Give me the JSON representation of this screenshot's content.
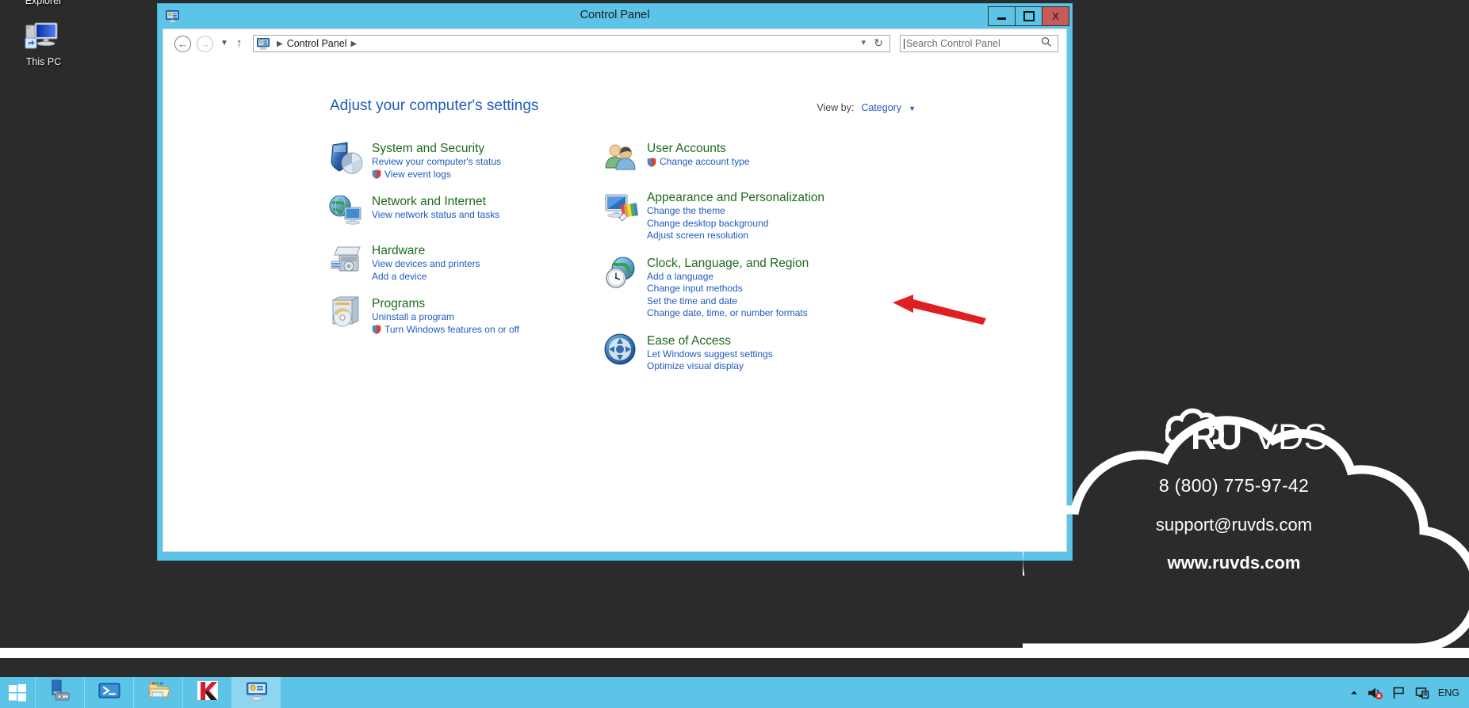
{
  "desktop": {
    "cut_off_label": "Explorer",
    "icons": [
      {
        "label": "This PC",
        "icon": "this-pc-icon"
      }
    ]
  },
  "window": {
    "title": "Control Panel",
    "title_icon": "control-panel-icon",
    "controls": {
      "minimize": "minimize-button",
      "maximize": "maximize-button",
      "close_label": "X"
    },
    "navbar": {
      "back": "back-button",
      "forward": "forward-button",
      "recent": "recent-locations-button",
      "up": "up-button",
      "address_icon": "control-panel-icon",
      "breadcrumb": "Control Panel",
      "dropdown": "address-dropdown",
      "refresh": "refresh-button",
      "search_placeholder": "Search Control Panel",
      "search_value": "",
      "search_icon": "search-icon"
    }
  },
  "content": {
    "heading": "Adjust your computer's settings",
    "view_by": {
      "label": "View by:",
      "value": "Category"
    },
    "left_column": [
      {
        "title": "System and Security",
        "icon": "shield-chart-icon",
        "links": [
          {
            "text": "Review your computer's status",
            "shield": false
          },
          {
            "text": "View event logs",
            "shield": true
          }
        ]
      },
      {
        "title": "Network and Internet",
        "icon": "globe-monitor-icon",
        "links": [
          {
            "text": "View network status and tasks",
            "shield": false
          }
        ]
      },
      {
        "title": "Hardware",
        "icon": "printer-icon",
        "links": [
          {
            "text": "View devices and printers",
            "shield": false
          },
          {
            "text": "Add a device",
            "shield": false
          }
        ]
      },
      {
        "title": "Programs",
        "icon": "programs-disc-icon",
        "links": [
          {
            "text": "Uninstall a program",
            "shield": false
          },
          {
            "text": "Turn Windows features on or off",
            "shield": true
          }
        ]
      }
    ],
    "right_column": [
      {
        "title": "User Accounts",
        "icon": "user-accounts-icon",
        "links": [
          {
            "text": "Change account type",
            "shield": true
          }
        ]
      },
      {
        "title": "Appearance and Personalization",
        "icon": "appearance-icon",
        "links": [
          {
            "text": "Change the theme",
            "shield": false
          },
          {
            "text": "Change desktop background",
            "shield": false
          },
          {
            "text": "Adjust screen resolution",
            "shield": false
          }
        ]
      },
      {
        "title": "Clock, Language, and Region",
        "icon": "clock-globe-icon",
        "links": [
          {
            "text": "Add a language",
            "shield": false
          },
          {
            "text": "Change input methods",
            "shield": false
          },
          {
            "text": "Set the time and date",
            "shield": false
          },
          {
            "text": "Change date, time, or number formats",
            "shield": false
          }
        ]
      },
      {
        "title": "Ease of Access",
        "icon": "ease-of-access-icon",
        "links": [
          {
            "text": "Let Windows suggest settings",
            "shield": false
          },
          {
            "text": "Optimize visual display",
            "shield": false
          }
        ]
      }
    ],
    "annotation": {
      "type": "red-arrow",
      "points_to": "Add a language",
      "color": "#e02020"
    }
  },
  "watermark": {
    "brand_ru": "RU",
    "brand_vds": "VDS",
    "phone": "8 (800) 775-97-42",
    "email": "support@ruvds.com",
    "site": "www.ruvds.com"
  },
  "taskbar": {
    "start": "start-button",
    "items": [
      {
        "name": "server-manager",
        "icon": "server-manager-icon",
        "active": false
      },
      {
        "name": "powershell",
        "icon": "powershell-icon",
        "active": false
      },
      {
        "name": "file-explorer",
        "icon": "file-explorer-icon",
        "active": false
      },
      {
        "name": "kaspersky",
        "icon": "kaspersky-icon",
        "active": false
      },
      {
        "name": "control-panel",
        "icon": "control-panel-icon",
        "active": true
      }
    ],
    "tray": {
      "show_hidden": "show-hidden-icons-arrow",
      "volume": "volume-muted-icon",
      "network": "network-flag-icon",
      "action_center": "action-center-icon",
      "language": "ENG"
    }
  },
  "colors": {
    "accent": "#5bc4e7",
    "desktop": "#2b2b2b",
    "link": "#1f5bbf",
    "category_title": "#1d6a1d",
    "close_button": "#c75b5b"
  }
}
